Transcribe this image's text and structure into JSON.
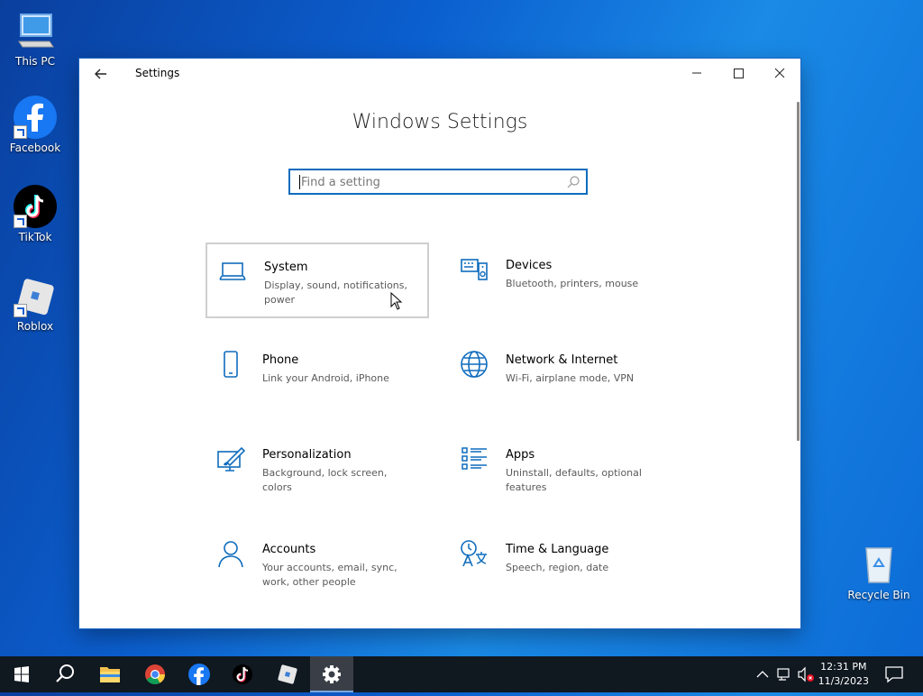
{
  "desktop": {
    "icons": [
      {
        "label": "This PC"
      },
      {
        "label": "Facebook"
      },
      {
        "label": "TikTok"
      },
      {
        "label": "Roblox"
      },
      {
        "label": "Recycle Bin"
      }
    ]
  },
  "window": {
    "title": "Settings",
    "heading": "Windows Settings",
    "search": {
      "placeholder": "Find a setting"
    },
    "tiles": [
      {
        "name": "System",
        "desc": "Display, sound, notifications, power",
        "icon": "laptop-icon"
      },
      {
        "name": "Devices",
        "desc": "Bluetooth, printers, mouse",
        "icon": "devices-icon"
      },
      {
        "name": "Phone",
        "desc": "Link your Android, iPhone",
        "icon": "phone-icon"
      },
      {
        "name": "Network & Internet",
        "desc": "Wi-Fi, airplane mode, VPN",
        "icon": "globe-icon"
      },
      {
        "name": "Personalization",
        "desc": "Background, lock screen, colors",
        "icon": "paint-icon"
      },
      {
        "name": "Apps",
        "desc": "Uninstall, defaults, optional features",
        "icon": "apps-list-icon"
      },
      {
        "name": "Accounts",
        "desc": "Your accounts, email, sync, work, other people",
        "icon": "person-icon"
      },
      {
        "name": "Time & Language",
        "desc": "Speech, region, date",
        "icon": "time-language-icon"
      }
    ]
  },
  "taskbar": {
    "time": "12:31 PM",
    "date": "11/3/2023"
  },
  "colors": {
    "accent": "#0f6cbd",
    "taskbar": "#101820"
  }
}
